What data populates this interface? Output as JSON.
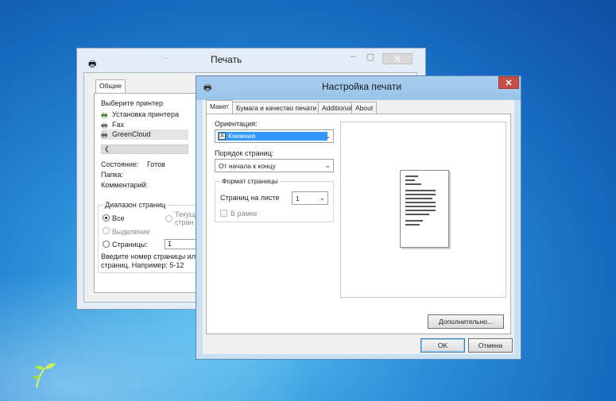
{
  "print_window": {
    "title": "Печать",
    "title_partial": "...",
    "tab_general": "Общие",
    "select_printer_label": "Выберите принтер",
    "printers": [
      {
        "name": "Установка принтера",
        "icon": "add-printer-icon"
      },
      {
        "name": "Fax",
        "icon": "fax-icon"
      },
      {
        "name": "GreenCloud",
        "icon": "printer-icon",
        "selected": true
      }
    ],
    "status_label": "Состояние:",
    "status_value": "Готов",
    "folder_label": "Папка:",
    "comment_label": "Комментарий:",
    "range_group": "Диапазон страниц",
    "range_all": "Все",
    "range_selection": "Выделение",
    "range_current_1": "Текущ",
    "range_current_2": "стран",
    "range_pages": "Страницы:",
    "pages_value": "1",
    "hint_1": "Введите номер страницы или",
    "hint_2": "страниц. Например: 5-12"
  },
  "setup_window": {
    "title": "Настройка печати",
    "tabs": [
      "Макет",
      "Бумага и качество печати",
      "Additional",
      "About"
    ],
    "active_tab": "Макет",
    "orientation_label": "Ориентация:",
    "orientation_value": "Книжная",
    "page_order_label": "Порядок страниц:",
    "page_order_value": "От начала к концу",
    "page_format_group": "Формат страницы",
    "pages_per_sheet_label": "Страниц на листе",
    "pages_per_sheet_value": "1",
    "border_label": "В рамке",
    "advanced_button": "Дополнительно...",
    "ok_button": "OK",
    "cancel_button": "Отмена"
  }
}
